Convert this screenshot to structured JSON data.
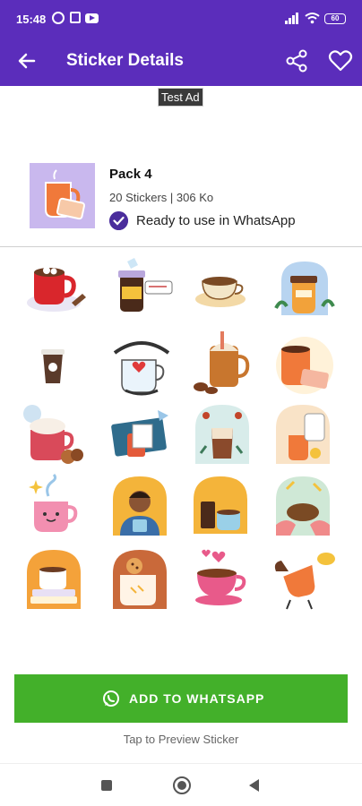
{
  "status_bar": {
    "time": "15:48",
    "battery": "60"
  },
  "app_bar": {
    "title": "Sticker Details",
    "back_icon": "arrow-left-icon",
    "share_icon": "share-icon",
    "favorite_icon": "heart-outline-icon"
  },
  "ad": {
    "label": "Test Ad"
  },
  "pack": {
    "title": "Pack 4",
    "meta": "20 Stickers | 306 Ko",
    "ready_text": "Ready to use in WhatsApp"
  },
  "stickers": [
    "red-mug-marshmallow",
    "coffee-jar-less-talk",
    "cup-and-saucer",
    "cup-with-flowers-frame",
    "small-coffee-cup",
    "coffee-is-better-mug",
    "iced-coffee-jar",
    "orange-mug-tray",
    "cocoa-cream-cookies",
    "laptop-coffee",
    "latte-glass-frame",
    "cup-kettle-orange",
    "smiling-pink-cup",
    "girl-with-cup",
    "coffee-press-cup",
    "hands-holding-cup",
    "cup-on-books",
    "cup-with-cookie",
    "pink-cup-hearts",
    "flying-cup-spill"
  ],
  "actions": {
    "add_label": "ADD TO WHATSAPP",
    "preview_hint": "Tap to Preview Sticker"
  },
  "colors": {
    "primary": "#5b2dbb",
    "accent_green": "#43b02a"
  }
}
